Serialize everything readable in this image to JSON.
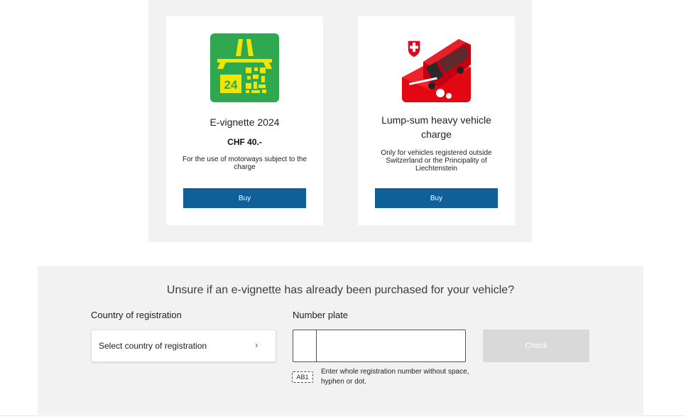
{
  "products": [
    {
      "title": "E-vignette 2024",
      "price": "CHF 40.-",
      "description": "For the use of motorways subject to the charge",
      "button": "Buy",
      "image_icon": "motorway-vignette-icon",
      "image_badge": "24"
    },
    {
      "title": "Lump-sum heavy vehicle charge",
      "price": "",
      "description": "Only for vehicles registered outside Switzerland or the Principality of Liechtenstein",
      "button": "Buy",
      "image_icon": "red-bus-icon"
    }
  ],
  "check": {
    "heading": "Unsure if an e-vignette has already been purchased for your vehicle?",
    "country_label": "Country of registration",
    "country_placeholder": "Select country of registration",
    "plate_label": "Number plate",
    "plate_value": "",
    "button": "Check",
    "hint_icon_text": "AB1",
    "hint": "Enter whole registration number without space, hyphen or dot."
  },
  "colors": {
    "primary": "#0e6198",
    "vignette_green": "#2fa84f",
    "vignette_yellow": "#f2e600",
    "swiss_red": "#e30613",
    "panel_bg": "#f2f2f2",
    "disabled": "#d9d9d9"
  }
}
